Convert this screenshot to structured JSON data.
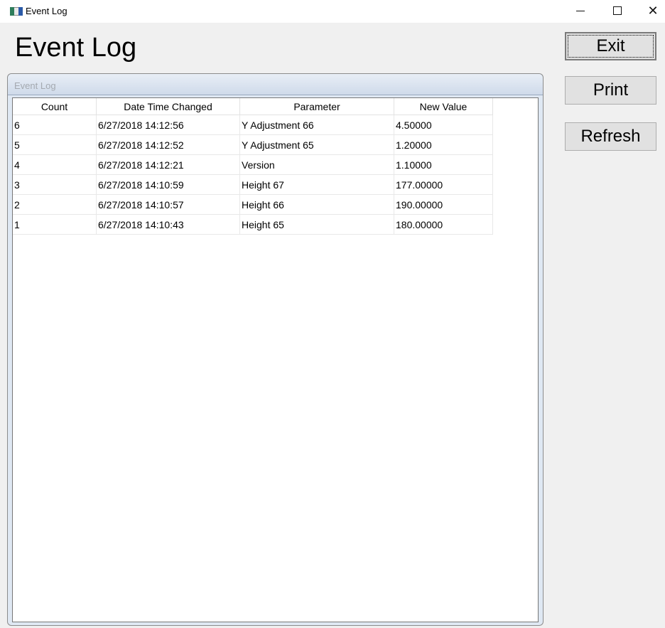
{
  "window": {
    "title": "Event Log",
    "minimize_glyph": "—",
    "maximize_glyph": "☐",
    "close_glyph": "✕"
  },
  "page": {
    "title": "Event Log"
  },
  "buttons": {
    "exit": "Exit",
    "print": "Print",
    "refresh": "Refresh"
  },
  "panel": {
    "caption": "Event Log"
  },
  "table": {
    "headers": [
      "Count",
      "Date Time Changed",
      "Parameter",
      "New Value"
    ],
    "rows": [
      [
        "6",
        "6/27/2018 14:12:56",
        "Y Adjustment 66",
        "4.50000"
      ],
      [
        "5",
        "6/27/2018 14:12:52",
        "Y Adjustment 65",
        "1.20000"
      ],
      [
        "4",
        "6/27/2018 14:12:21",
        "Version",
        "1.10000"
      ],
      [
        "3",
        "6/27/2018 14:10:59",
        "Height 67",
        "177.00000"
      ],
      [
        "2",
        "6/27/2018 14:10:57",
        "Height 66",
        "190.00000"
      ],
      [
        "1",
        "6/27/2018 14:10:43",
        "Height 65",
        "180.00000"
      ]
    ]
  }
}
